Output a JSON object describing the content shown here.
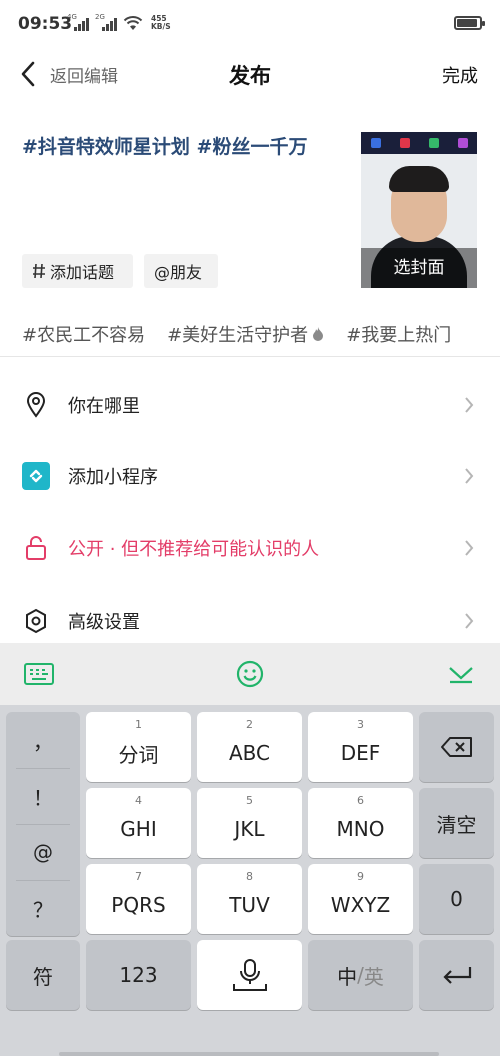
{
  "status": {
    "time": "09:53",
    "signal1_tag": "4G",
    "signal2_tag": "2G",
    "net_speed_value": "455",
    "net_speed_unit": "KB/S",
    "battery_level": 0.85
  },
  "header": {
    "back_label": "返回编辑",
    "title": "发布",
    "done_label": "完成"
  },
  "post": {
    "caption": "#抖音特效师星计划 #粉丝一千万",
    "cover_label": "选封面"
  },
  "chips": {
    "topic_label": "添加话题",
    "friend_label": "@朋友"
  },
  "suggestions": [
    "#农民工不容易",
    "#美好生活守护者",
    "#我要上热门"
  ],
  "settings": {
    "location_label": "你在哪里",
    "miniapp_label": "添加小程序",
    "privacy_label": "公开 · 但不推荐给可能认识的人",
    "advanced_label": "高级设置"
  },
  "colors": {
    "hashtag_blue": "#2b4b77",
    "privacy_red": "#e33d68",
    "accent_green": "#21b46a",
    "miniapp_teal": "#1fb6c9"
  },
  "keyboard": {
    "symbols": [
      "，",
      "！",
      "@",
      "？"
    ],
    "keys": {
      "k1": {
        "num": "1",
        "label": "分词"
      },
      "k2": {
        "num": "2",
        "label": "ABC"
      },
      "k3": {
        "num": "3",
        "label": "DEF"
      },
      "k4": {
        "num": "4",
        "label": "GHI"
      },
      "k5": {
        "num": "5",
        "label": "JKL"
      },
      "k6": {
        "num": "6",
        "label": "MNO"
      },
      "k7": {
        "num": "7",
        "label": "PQRS"
      },
      "k8": {
        "num": "8",
        "label": "TUV"
      },
      "k9": {
        "num": "9",
        "label": "WXYZ"
      }
    },
    "clear_label": "清空",
    "zero_label": "0",
    "symbol_label": "符",
    "numeric_label": "123",
    "lang_label_cn": "中",
    "lang_label_sep": "/",
    "lang_label_en": "英"
  }
}
